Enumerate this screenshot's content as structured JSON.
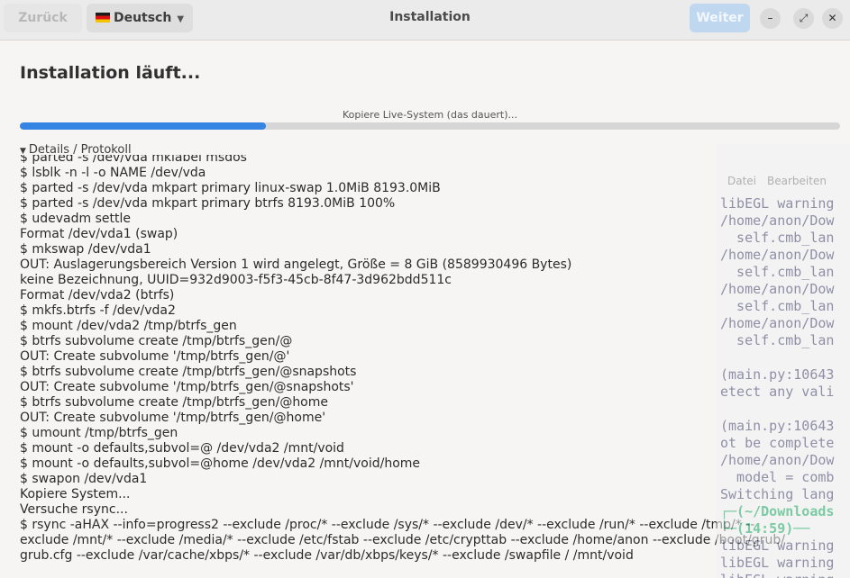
{
  "header": {
    "back_label": "Zurück",
    "language_label": "Deutsch",
    "title": "Installation",
    "next_label": "Weiter"
  },
  "window_controls": {
    "minimize": "–",
    "maximize": "⤢",
    "close": "✕"
  },
  "page": {
    "heading": "Installation läuft...",
    "progress_text": "Kopiere Live-System (das dauert)...",
    "progress_fraction": 0.3,
    "details_label": "Details / Protokoll"
  },
  "log": [
    "$ parted -s /dev/vda mklabel msdos",
    "$ lsblk -n -l -o NAME /dev/vda",
    "$ parted -s /dev/vda mkpart primary linux-swap 1.0MiB 8193.0MiB",
    "$ parted -s /dev/vda mkpart primary btrfs 8193.0MiB 100%",
    "$ udevadm settle",
    "Format /dev/vda1 (swap)",
    "$ mkswap /dev/vda1",
    "OUT: Auslagerungsbereich Version 1 wird angelegt, Größe = 8 GiB (8589930496 Bytes)",
    "keine Bezeichnung, UUID=932d9003-f5f3-45cb-8f47-3d962bdd511c",
    "Format /dev/vda2 (btrfs)",
    "$ mkfs.btrfs -f /dev/vda2",
    "$ mount /dev/vda2 /tmp/btrfs_gen",
    "$ btrfs subvolume create /tmp/btrfs_gen/@",
    "OUT: Create subvolume '/tmp/btrfs_gen/@'",
    "$ btrfs subvolume create /tmp/btrfs_gen/@snapshots",
    "OUT: Create subvolume '/tmp/btrfs_gen/@snapshots'",
    "$ btrfs subvolume create /tmp/btrfs_gen/@home",
    "OUT: Create subvolume '/tmp/btrfs_gen/@home'",
    "$ umount /tmp/btrfs_gen",
    "$ mount -o defaults,subvol=@ /dev/vda2 /mnt/void",
    "$ mount -o defaults,subvol=@home /dev/vda2 /mnt/void/home",
    "$ swapon /dev/vda1",
    "Kopiere System...",
    "Versuche rsync...",
    "$ rsync -aHAX --info=progress2 --exclude /proc/* --exclude /sys/* --exclude /dev/* --exclude /run/* --exclude /tmp/* --",
    "exclude /mnt/* --exclude /media/* --exclude /etc/fstab --exclude /etc/crypttab --exclude /home/anon --exclude /boot/grub/",
    "grub.cfg --exclude /var/cache/xbps/* --exclude /var/db/xbps/keys/* --exclude /swapfile / /mnt/void"
  ],
  "terminal": {
    "menu": [
      "Datei",
      "Bearbeiten"
    ],
    "lines": [
      "libEGL warning",
      "/home/anon/Dow",
      "  self.cmb_lan",
      "/home/anon/Dow",
      "  self.cmb_lan",
      "/home/anon/Dow",
      "  self.cmb_lan",
      "/home/anon/Dow",
      "  self.cmb_lan",
      "",
      "(main.py:10643",
      "etect any vali",
      "",
      "(main.py:10643",
      "ot be complete",
      "/home/anon/Dow",
      "  model = comb",
      "Switching lang",
      "┌─(~/Downloads",
      "└─(14:59)──",
      "libEGL warning",
      "libEGL warning",
      "libEGL warning"
    ]
  }
}
